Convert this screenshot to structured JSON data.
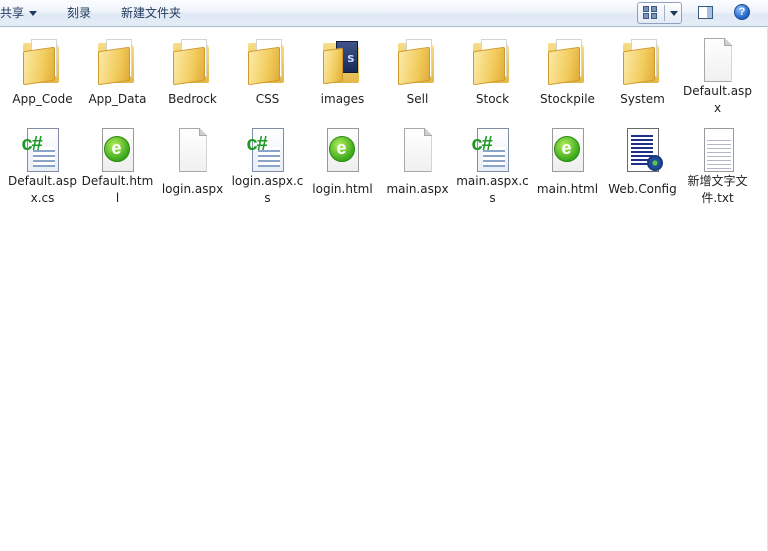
{
  "toolbar": {
    "share_label": "共享",
    "burn_label": "刻录",
    "new_folder_label": "新建文件夹",
    "help_label": "?"
  },
  "items": [
    {
      "name": "App_Code",
      "type": "folder"
    },
    {
      "name": "App_Data",
      "type": "folder"
    },
    {
      "name": "Bedrock",
      "type": "folder"
    },
    {
      "name": "CSS",
      "type": "folder"
    },
    {
      "name": "images",
      "type": "folder-book"
    },
    {
      "name": "Sell",
      "type": "folder"
    },
    {
      "name": "Stock",
      "type": "folder"
    },
    {
      "name": "Stockpile",
      "type": "folder"
    },
    {
      "name": "System",
      "type": "folder"
    },
    {
      "name": "Default.aspx",
      "type": "blank"
    },
    {
      "name": "Default.aspx.cs",
      "type": "cs"
    },
    {
      "name": "Default.html",
      "type": "html"
    },
    {
      "name": "login.aspx",
      "type": "blank"
    },
    {
      "name": "login.aspx.cs",
      "type": "cs"
    },
    {
      "name": "login.html",
      "type": "html"
    },
    {
      "name": "main.aspx",
      "type": "blank"
    },
    {
      "name": "main.aspx.cs",
      "type": "cs"
    },
    {
      "name": "main.html",
      "type": "html"
    },
    {
      "name": "Web.Config",
      "type": "config"
    },
    {
      "name": "新增文字文件.txt",
      "type": "txt"
    }
  ]
}
